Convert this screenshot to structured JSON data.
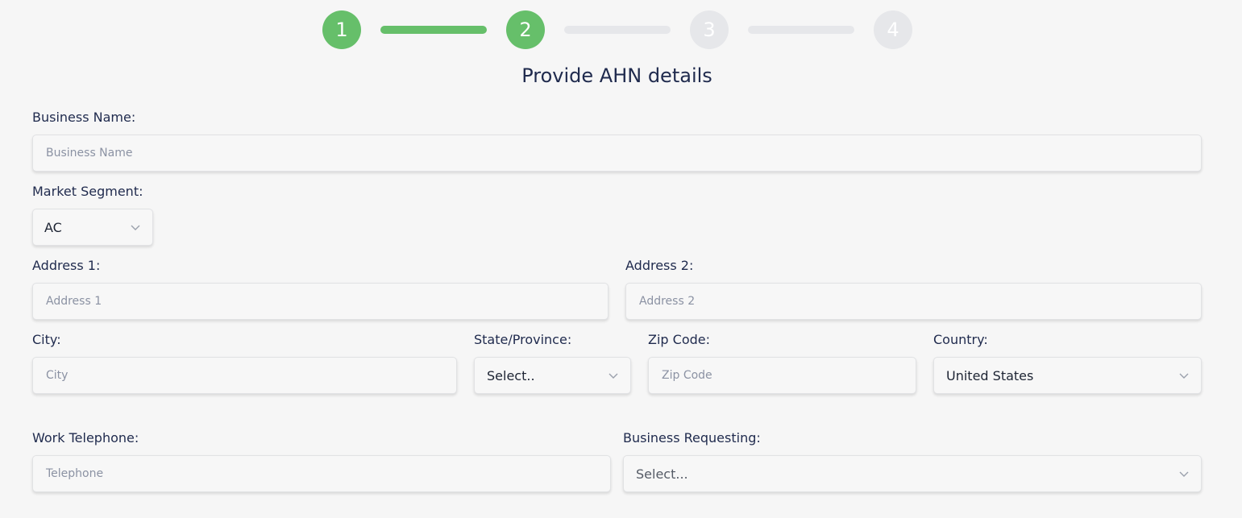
{
  "stepper": {
    "steps": [
      {
        "label": "1",
        "state": "done"
      },
      {
        "label": "2",
        "state": "active"
      },
      {
        "label": "3",
        "state": "todo"
      },
      {
        "label": "4",
        "state": "todo"
      }
    ],
    "connectors_filled": [
      true,
      false,
      false
    ]
  },
  "colors": {
    "accent": "#66bf6a",
    "inactive": "#e6e7ea",
    "text": "#1f2a4d"
  },
  "page_title": "Provide AHN details",
  "form": {
    "business_name": {
      "label": "Business Name:",
      "placeholder": "Business Name"
    },
    "market_segment": {
      "label": "Market Segment:",
      "value": "AC",
      "icon": "chevron-down-icon"
    },
    "address1": {
      "label": "Address 1:",
      "placeholder": "Address 1"
    },
    "address2": {
      "label": "Address 2:",
      "placeholder": "Address 2"
    },
    "city": {
      "label": "City:",
      "placeholder": "City"
    },
    "state": {
      "label": "State/Province:",
      "value": "Select..",
      "icon": "chevron-down-icon"
    },
    "zip": {
      "label": "Zip Code:",
      "placeholder": "Zip Code"
    },
    "country": {
      "label": "Country:",
      "value": "United States",
      "icon": "chevron-down-icon"
    },
    "work_telephone": {
      "label": "Work Telephone:",
      "placeholder": "Telephone"
    },
    "business_requesting": {
      "label": "Business Requesting:",
      "value": "Select...",
      "icon": "chevron-down-icon"
    }
  }
}
